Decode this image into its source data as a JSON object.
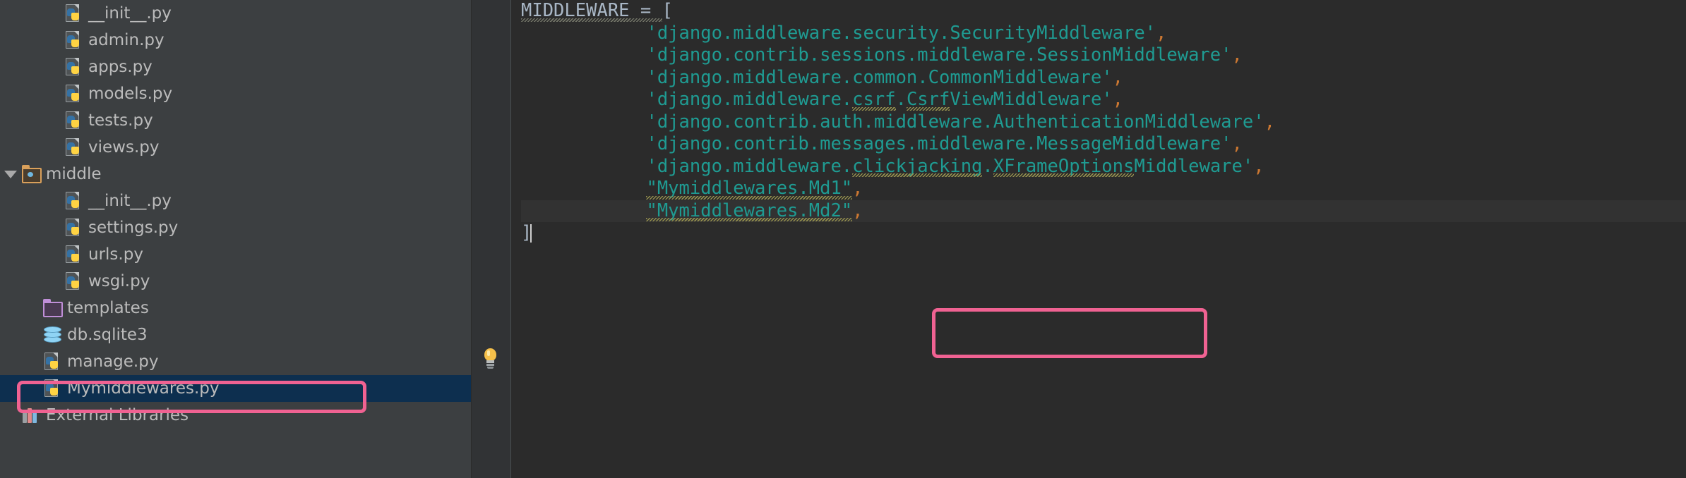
{
  "app": {
    "theme_background": "#3c3f41",
    "editor_background": "#2b2b2b",
    "accent_highlight": "#f06292",
    "string_color": "#1f9b92",
    "punctuation_color": "#cc7832",
    "selected_row_color": "#0d2f4f"
  },
  "sidebar": {
    "name": "project-tree",
    "items": [
      {
        "label": "__init__.py",
        "icon": "python-file-icon",
        "indent": 3,
        "twisty": false,
        "selected": false,
        "partial_top": false
      },
      {
        "label": "admin.py",
        "icon": "python-file-icon",
        "indent": 3,
        "twisty": false,
        "selected": false
      },
      {
        "label": "apps.py",
        "icon": "python-file-icon",
        "indent": 3,
        "twisty": false,
        "selected": false
      },
      {
        "label": "models.py",
        "icon": "python-file-icon",
        "indent": 3,
        "twisty": false,
        "selected": false
      },
      {
        "label": "tests.py",
        "icon": "python-file-icon",
        "indent": 3,
        "twisty": false,
        "selected": false
      },
      {
        "label": "views.py",
        "icon": "python-file-icon",
        "indent": 3,
        "twisty": false,
        "selected": false
      },
      {
        "label": "middle",
        "icon": "module-folder-icon",
        "indent": 1,
        "twisty": true,
        "selected": false
      },
      {
        "label": "__init__.py",
        "icon": "python-file-icon",
        "indent": 3,
        "twisty": false,
        "selected": false
      },
      {
        "label": "settings.py",
        "icon": "python-file-icon",
        "indent": 3,
        "twisty": false,
        "selected": false
      },
      {
        "label": "urls.py",
        "icon": "python-file-icon",
        "indent": 3,
        "twisty": false,
        "selected": false
      },
      {
        "label": "wsgi.py",
        "icon": "python-file-icon",
        "indent": 3,
        "twisty": false,
        "selected": false
      },
      {
        "label": "templates",
        "icon": "templates-folder-icon",
        "indent": 2,
        "twisty": false,
        "selected": false
      },
      {
        "label": "db.sqlite3",
        "icon": "database-icon",
        "indent": 2,
        "twisty": false,
        "selected": false
      },
      {
        "label": "manage.py",
        "icon": "python-file-icon",
        "indent": 2,
        "twisty": false,
        "selected": false
      },
      {
        "label": "Mymiddlewares.py",
        "icon": "python-file-icon",
        "indent": 2,
        "twisty": false,
        "selected": true
      },
      {
        "label": "External Libraries",
        "icon": "external-libraries-icon",
        "indent": 1,
        "twisty": false,
        "selected": false
      }
    ]
  },
  "editor": {
    "name": "settings-py-editor",
    "gutter": {
      "bulb_icon": "lightbulb-intention-icon"
    },
    "lines": [
      {
        "indent": 0,
        "segments": [
          {
            "text": "MIDDLEWARE",
            "style": "plain",
            "squiggly": true
          },
          {
            "text": " = ",
            "style": "plain",
            "squiggly": true
          },
          {
            "text": "[",
            "style": "bracket",
            "squiggly": false
          }
        ]
      },
      {
        "indent": 4,
        "segments": [
          {
            "text": "'django.middleware.security.SecurityMiddleware'",
            "style": "string",
            "squiggly": false
          },
          {
            "text": ",",
            "style": "punc",
            "squiggly": false
          }
        ]
      },
      {
        "indent": 4,
        "segments": [
          {
            "text": "'django.contrib.sessions.middleware.SessionMiddleware'",
            "style": "string",
            "squiggly": false
          },
          {
            "text": ",",
            "style": "punc",
            "squiggly": false
          }
        ]
      },
      {
        "indent": 4,
        "segments": [
          {
            "text": "'django.middleware.common.CommonMiddleware'",
            "style": "string",
            "squiggly": false
          },
          {
            "text": ",",
            "style": "punc",
            "squiggly": false
          }
        ]
      },
      {
        "indent": 4,
        "segments": [
          {
            "text": "'django.middleware.",
            "style": "string",
            "squiggly": false
          },
          {
            "text": "csrf",
            "style": "string",
            "squiggly": true
          },
          {
            "text": ".",
            "style": "string",
            "squiggly": false
          },
          {
            "text": "Csrf",
            "style": "string",
            "squiggly": true
          },
          {
            "text": "ViewMiddleware'",
            "style": "string",
            "squiggly": false
          },
          {
            "text": ",",
            "style": "punc",
            "squiggly": false
          }
        ]
      },
      {
        "indent": 4,
        "segments": [
          {
            "text": "'django.contrib.auth.middleware.AuthenticationMiddleware'",
            "style": "string",
            "squiggly": false
          },
          {
            "text": ",",
            "style": "punc",
            "squiggly": false
          }
        ]
      },
      {
        "indent": 4,
        "segments": [
          {
            "text": "'django.contrib.messages.middleware.MessageMiddleware'",
            "style": "string",
            "squiggly": false
          },
          {
            "text": ",",
            "style": "punc",
            "squiggly": false
          }
        ]
      },
      {
        "indent": 4,
        "segments": [
          {
            "text": "'django.middleware.",
            "style": "string",
            "squiggly": false
          },
          {
            "text": "clickjacking",
            "style": "string",
            "squiggly": true
          },
          {
            "text": ".",
            "style": "string",
            "squiggly": false
          },
          {
            "text": "XFrameOptions",
            "style": "string",
            "squiggly": true
          },
          {
            "text": "Middleware'",
            "style": "string",
            "squiggly": false
          },
          {
            "text": ",",
            "style": "punc",
            "squiggly": false
          }
        ]
      },
      {
        "indent": 4,
        "segments": [
          {
            "text": "\"Mymiddlewares.Md1\"",
            "style": "string",
            "squiggly": true
          },
          {
            "text": ",",
            "style": "punc",
            "squiggly": false
          }
        ]
      },
      {
        "indent": 4,
        "caret": true,
        "segments": [
          {
            "text": "\"Mymiddlewares.Md2\"",
            "style": "string",
            "squiggly": true
          },
          {
            "text": ",",
            "style": "punc",
            "squiggly": false
          }
        ]
      },
      {
        "indent": 0,
        "segments": [
          {
            "text": "]",
            "style": "bracket",
            "squiggly": false
          }
        ]
      }
    ]
  },
  "annotations": [
    {
      "name": "tree-selection-callout",
      "target": "Mymiddlewares.py",
      "color": "#f06292"
    },
    {
      "name": "code-lines-callout",
      "target": "custom middleware entries",
      "color": "#f06292"
    }
  ]
}
